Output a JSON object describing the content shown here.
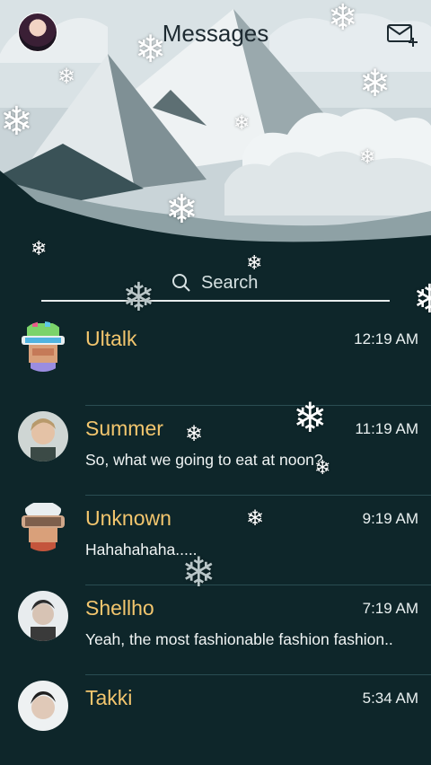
{
  "header": {
    "title": "Messages",
    "avatar_icon": "profile-avatar",
    "compose_icon": "new-message-icon"
  },
  "search": {
    "label": "Search",
    "icon": "search-icon"
  },
  "conversations": [
    {
      "name": "Ultalk",
      "time": "12:19 AM",
      "preview": "",
      "avatar": "robot-avatar"
    },
    {
      "name": "Summer",
      "time": "11:19 AM",
      "preview": "So, what we going to eat at noon?",
      "avatar": "photo-avatar"
    },
    {
      "name": "Unknown",
      "time": "9:19 AM",
      "preview": "Hahahahaha.....",
      "avatar": "goggle-avatar"
    },
    {
      "name": "Shellho",
      "time": "7:19 AM",
      "preview": "Yeah, the most fashionable fashion fashion..",
      "avatar": "photo-avatar"
    },
    {
      "name": "Takki",
      "time": "5:34 AM",
      "preview": "",
      "avatar": "photo-avatar"
    }
  ],
  "colors": {
    "background": "#0e262a",
    "name": "#f3c66e",
    "text": "#f0f4f4"
  }
}
